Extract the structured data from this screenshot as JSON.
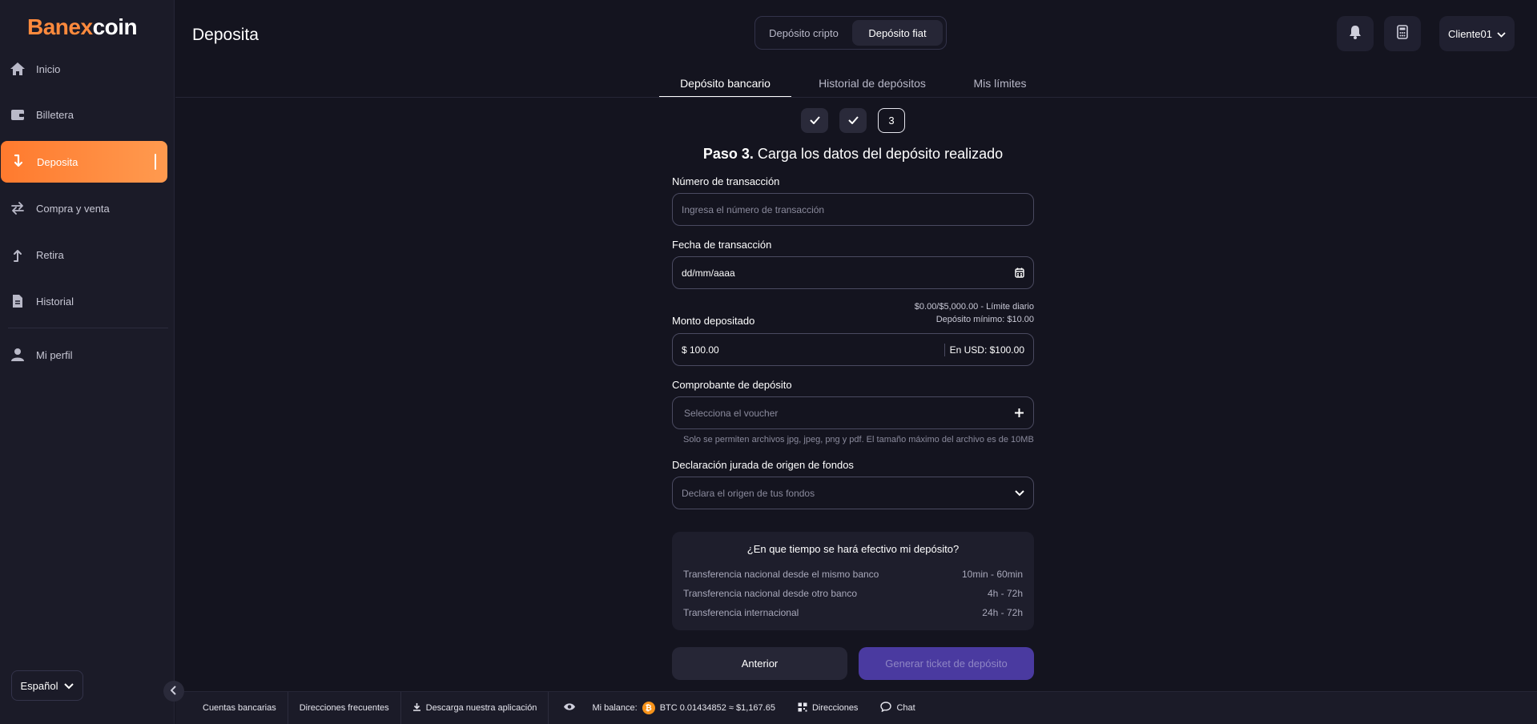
{
  "brand": {
    "first": "B",
    "mid": "anex",
    "rest": "coin"
  },
  "sidebar": {
    "items": [
      {
        "label": "Inicio"
      },
      {
        "label": "Billetera"
      },
      {
        "label": "Deposita"
      },
      {
        "label": "Compra y venta"
      },
      {
        "label": "Retira"
      },
      {
        "label": "Historial"
      },
      {
        "label": "Mi perfil"
      }
    ],
    "language": "Español"
  },
  "header": {
    "title": "Deposita",
    "segments": [
      "Depósito cripto",
      "Depósito fiat"
    ],
    "user": "Cliente01"
  },
  "tabs": [
    "Depósito bancario",
    "Historial de depósitos",
    "Mis límites"
  ],
  "steps": {
    "current": "3"
  },
  "form": {
    "title_bold": "Paso 3.",
    "title_rest": " Carga los datos del depósito realizado",
    "tx_label": "Número de transacción",
    "tx_placeholder": "Ingresa el número de transacción",
    "date_label": "Fecha de transacción",
    "date_value": "dd/mm/aaaa",
    "limit_daily": "$0.00/$5,000.00 - Límite diario",
    "limit_min": "Depósito mínimo: $10.00",
    "amount_label": "Monto depositado",
    "amount_value": "$ 100.00",
    "amount_usd": "En USD: $100.00",
    "voucher_label": "Comprobante de depósito",
    "voucher_placeholder": "Selecciona el voucher",
    "voucher_note": "Solo se permiten archivos jpg, jpeg, png y pdf. El tamaño máximo del archivo es de 10MB",
    "origin_label": "Declaración jurada de origen de fondos",
    "origin_placeholder": "Declara el origen de tus fondos"
  },
  "info": {
    "question": "¿En que tiempo se hará efectivo mi depósito?",
    "rows": [
      {
        "label": "Transferencia nacional desde el mismo banco",
        "time": "10min - 60min"
      },
      {
        "label": "Transferencia nacional desde otro banco",
        "time": "4h - 72h"
      },
      {
        "label": "Transferencia internacional",
        "time": "24h - 72h"
      }
    ]
  },
  "buttons": {
    "prev": "Anterior",
    "generate": "Generar ticket de depósito"
  },
  "footer": {
    "bank_accounts": "Cuentas bancarias",
    "frequent_addresses": "Direcciones frecuentes",
    "download": "Descarga nuestra aplicación",
    "balance_label": "Mi balance:",
    "balance_value": "BTC 0.01434852 ≈ $1,167.65",
    "addresses": "Direcciones",
    "chat": "Chat"
  },
  "colors": {
    "accent": "#ff8a3d",
    "primary_button": "#4a3aa0",
    "background": "#14141f"
  }
}
